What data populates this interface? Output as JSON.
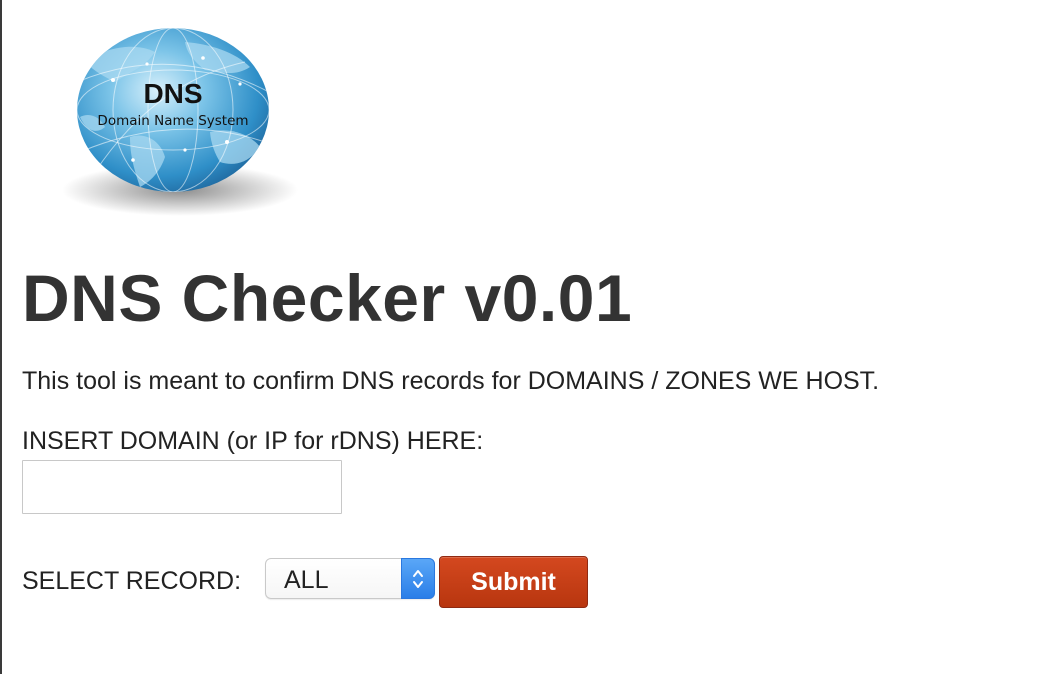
{
  "logo": {
    "title": "DNS",
    "subtitle": "Domain Name System",
    "icon": "globe-icon"
  },
  "page": {
    "title": "DNS Checker v0.01",
    "description": "This tool is meant to confirm DNS records for DOMAINS / ZONES WE HOST."
  },
  "form": {
    "domain_label": "INSERT DOMAIN (or IP for rDNS) HERE:",
    "domain_value": "",
    "record_label": "SELECT RECORD:",
    "record_selected": "ALL",
    "submit_label": "Submit"
  },
  "colors": {
    "submit_bg": "#c13e16",
    "select_arrow_bg": "#3b8ef0",
    "title_text": "#333333"
  }
}
